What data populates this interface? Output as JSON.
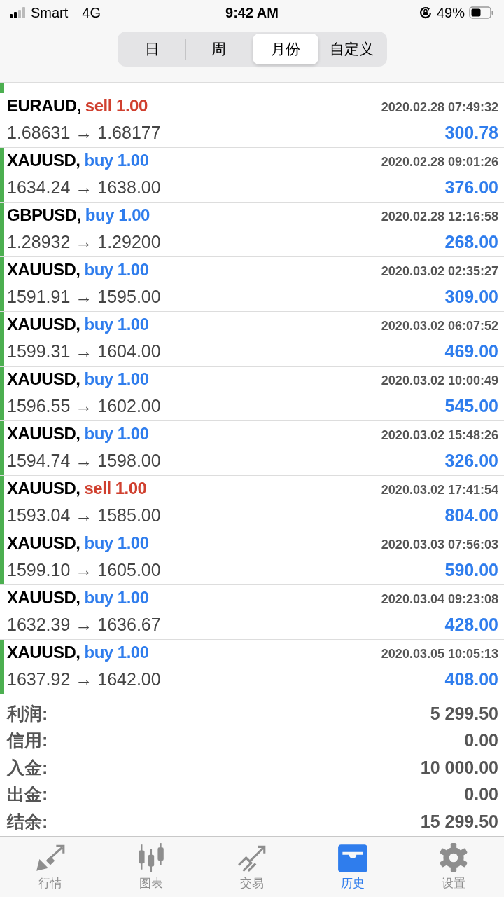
{
  "status_bar": {
    "carrier": "Smart",
    "network": "4G",
    "time": "9:42 AM",
    "battery": "49%"
  },
  "period_tabs": [
    {
      "label": "日",
      "selected": false
    },
    {
      "label": "周",
      "selected": false
    },
    {
      "label": "月份",
      "selected": true
    },
    {
      "label": "自定义",
      "selected": false
    }
  ],
  "deals": [
    {
      "symbol": "EURAUD,",
      "color": "#d0402f",
      "type": "sell 1.00",
      "time": "2020.02.28 07:49:32",
      "prices": "1.68631 → 1.68177",
      "profit": "300.78",
      "marked": false
    },
    {
      "symbol": "XAUUSD,",
      "color": "#2f7ded",
      "type": "buy 1.00",
      "time": "2020.02.28 09:01:26",
      "prices": "1634.24 → 1638.00",
      "profit": "376.00",
      "marked": true
    },
    {
      "symbol": "GBPUSD,",
      "color": "#2f7ded",
      "type": "buy 1.00",
      "time": "2020.02.28 12:16:58",
      "prices": "1.28932 → 1.29200",
      "profit": "268.00",
      "marked": true
    },
    {
      "symbol": "XAUUSD,",
      "color": "#2f7ded",
      "type": "buy 1.00",
      "time": "2020.03.02 02:35:27",
      "prices": "1591.91 → 1595.00",
      "profit": "309.00",
      "marked": true
    },
    {
      "symbol": "XAUUSD,",
      "color": "#2f7ded",
      "type": "buy 1.00",
      "time": "2020.03.02 06:07:52",
      "prices": "1599.31 → 1604.00",
      "profit": "469.00",
      "marked": true
    },
    {
      "symbol": "XAUUSD,",
      "color": "#2f7ded",
      "type": "buy 1.00",
      "time": "2020.03.02 10:00:49",
      "prices": "1596.55 → 1602.00",
      "profit": "545.00",
      "marked": true
    },
    {
      "symbol": "XAUUSD,",
      "color": "#2f7ded",
      "type": "buy 1.00",
      "time": "2020.03.02 15:48:26",
      "prices": "1594.74 → 1598.00",
      "profit": "326.00",
      "marked": true
    },
    {
      "symbol": "XAUUSD,",
      "color": "#d0402f",
      "type": "sell 1.00",
      "time": "2020.03.02 17:41:54",
      "prices": "1593.04 → 1585.00",
      "profit": "804.00",
      "marked": true
    },
    {
      "symbol": "XAUUSD,",
      "color": "#2f7ded",
      "type": "buy 1.00",
      "time": "2020.03.03 07:56:03",
      "prices": "1599.10 → 1605.00",
      "profit": "590.00",
      "marked": true
    },
    {
      "symbol": "XAUUSD,",
      "color": "#2f7ded",
      "type": "buy 1.00",
      "time": "2020.03.04 09:23:08",
      "prices": "1632.39 → 1636.67",
      "profit": "428.00",
      "marked": false
    },
    {
      "symbol": "XAUUSD,",
      "color": "#2f7ded",
      "type": "buy 1.00",
      "time": "2020.03.05 10:05:13",
      "prices": "1637.92 → 1642.00",
      "profit": "408.00",
      "marked": true
    }
  ],
  "summary": [
    {
      "label": "利润:",
      "value": "5 299.50"
    },
    {
      "label": "信用:",
      "value": "0.00"
    },
    {
      "label": "入金:",
      "value": "10 000.00"
    },
    {
      "label": "出金:",
      "value": "0.00"
    },
    {
      "label": "结余:",
      "value": "15 299.50"
    }
  ],
  "bottom_tabs": [
    {
      "label": "行情",
      "kind": "quotes",
      "selected": false
    },
    {
      "label": "图表",
      "kind": "chart",
      "selected": false
    },
    {
      "label": "交易",
      "kind": "trade",
      "selected": false
    },
    {
      "label": "历史",
      "kind": "history",
      "selected": true
    },
    {
      "label": "设置",
      "kind": "settings",
      "selected": false
    }
  ]
}
